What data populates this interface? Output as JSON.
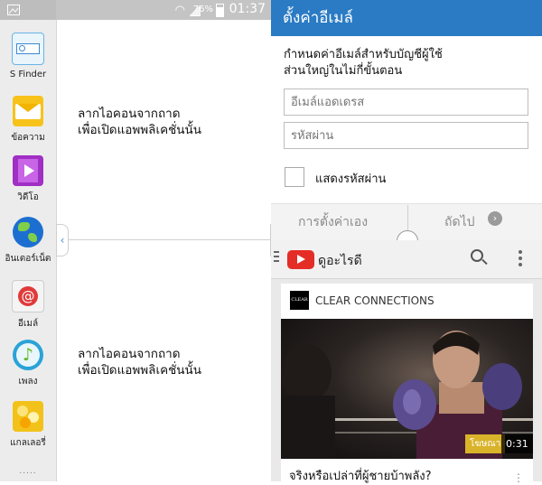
{
  "status_bar": {
    "battery": "76%",
    "time": "01:37"
  },
  "tray": {
    "apps": [
      {
        "label": "S Finder",
        "icon": "s-finder-icon",
        "color": "#4aa3e0"
      },
      {
        "label": "ข้อความ",
        "icon": "message-icon",
        "color": "#f7c21a"
      },
      {
        "label": "วิดีโอ",
        "icon": "video-icon",
        "color": "#a02fc4"
      },
      {
        "label": "อินเตอร์เน็ต",
        "icon": "internet-icon",
        "color": "#1c6fd1"
      },
      {
        "label": "อีเมล์",
        "icon": "email-icon",
        "color": "#e03a3a"
      },
      {
        "label": "เพลง",
        "icon": "music-icon",
        "color": "#2aa3d8"
      },
      {
        "label": "แกลเลอรี่",
        "icon": "gallery-icon",
        "color": "#f2c21b"
      }
    ],
    "dots": "....."
  },
  "split": {
    "top_hint_line1": "ลากไอคอนจากถาด",
    "top_hint_line2": "เพื่อเปิดแอพพลิเคชั่นนั้น",
    "bottom_hint_line1": "ลากไอคอนจากถาด",
    "bottom_hint_line2": "เพื่อเปิดแอพพลิเคชั่นนั้น"
  },
  "email": {
    "header": "ตั้งค่าอีเมล์",
    "instruction_line1": "กำหนดค่าอีเมล์สำหรับบัญชีผู้ใช้",
    "instruction_line2": "ส่วนใหญ่ในไม่กี่ขั้นตอน",
    "address_placeholder": "อีเมล์แอดเดรส",
    "password_placeholder": "รหัสผ่าน",
    "show_password_label": "แสดงรหัสผ่าน",
    "manual_setup": "การตั้งค่าเอง",
    "next": "ถัดไป",
    "header_color": "#2a7bc4"
  },
  "youtube": {
    "title": "ดูอะไรดี",
    "channel": "CLEAR CONNECTIONS",
    "channel_logo_text": "CLEAR",
    "ad_label": "โฆษณา",
    "duration": "0:31",
    "video_title": "จริงหรือเปล่าที่ผู้ชายบ้าพลัง?"
  }
}
